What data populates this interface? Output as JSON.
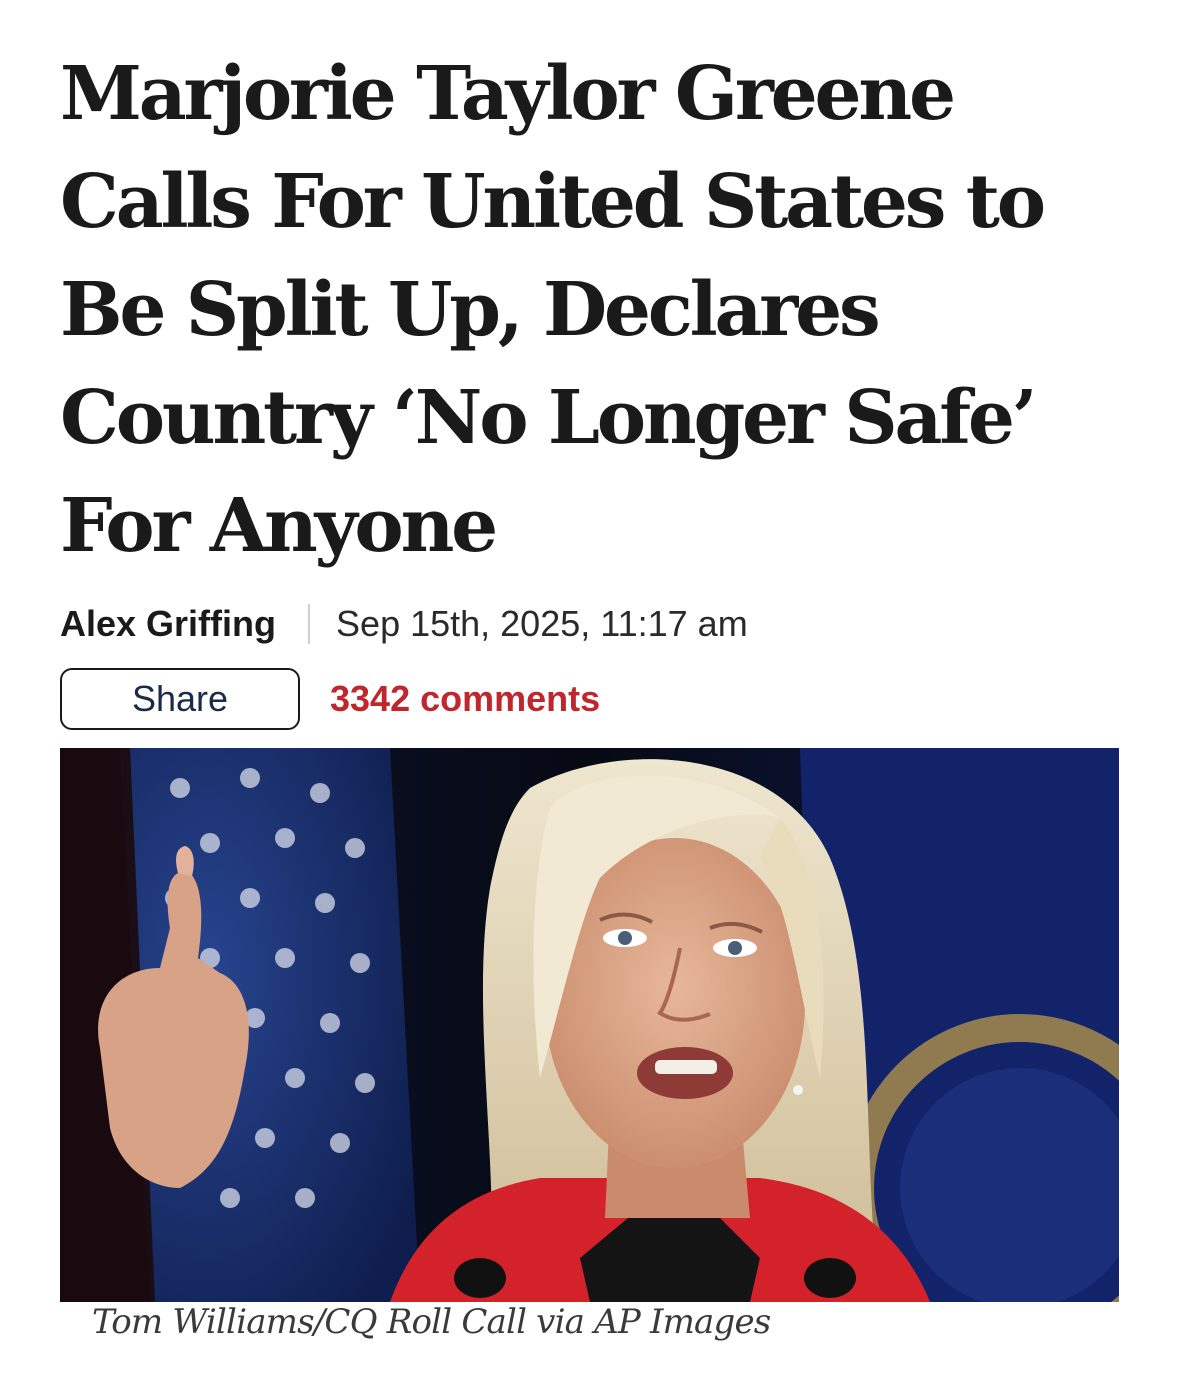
{
  "article": {
    "headline": "Marjorie Taylor Greene\nCalls For United States to\nBe Split Up, Declares\nCountry ‘No Longer Safe’\nFor Anyone",
    "author": "Alex Griffing",
    "date": "Sep 15th, 2025, 11:17 am",
    "share_label": "Share",
    "comments_label": "3342 comments",
    "photo_caption": "Tom Williams/CQ Roll Call via AP Images"
  },
  "colors": {
    "headline": "#1a1a1a",
    "comments_accent": "#c0272d",
    "share_text": "#1a2a4a"
  }
}
